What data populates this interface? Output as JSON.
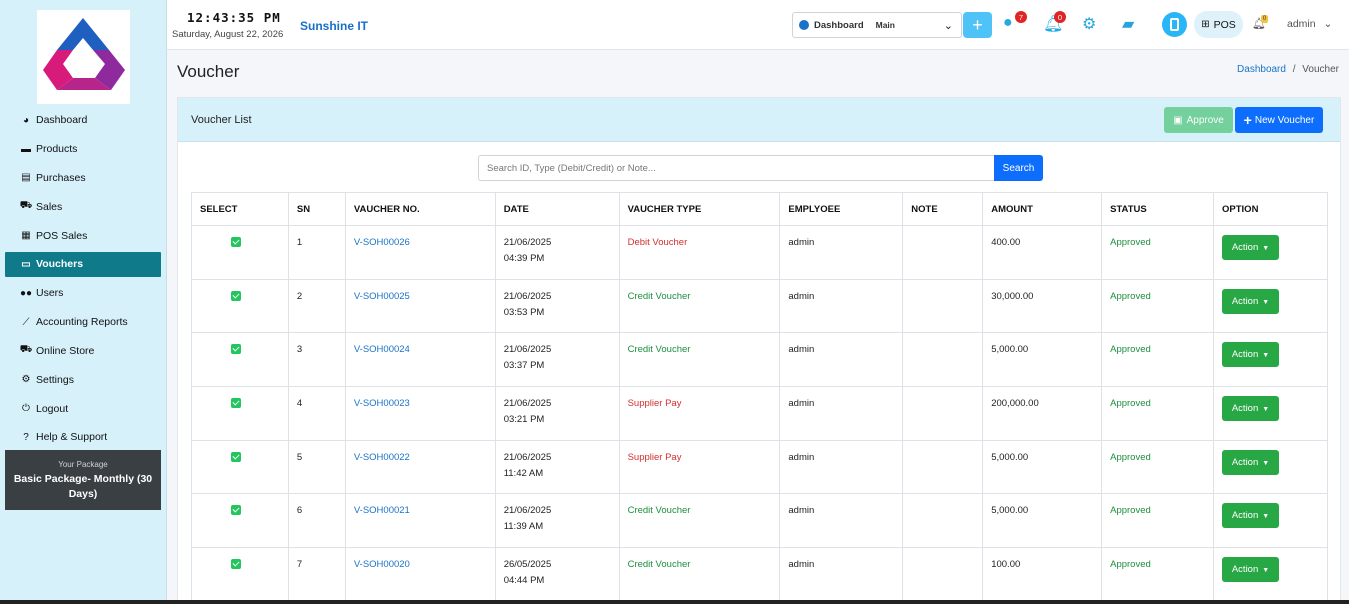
{
  "header": {
    "clock": "12:43:35 PM",
    "date": "Saturday, August 22, 2026",
    "brand": "Sunshine IT",
    "dashboard_select_label": "Dashboard",
    "dashboard_select_value": "Main",
    "notif_count_1": "7",
    "notif_count_2": "0",
    "pos_label": "POS",
    "bell_count": "0",
    "user": "admin"
  },
  "sidebar": {
    "items": [
      {
        "label": "Dashboard",
        "icon": "dashboard-icon"
      },
      {
        "label": "Products",
        "icon": "box-icon"
      },
      {
        "label": "Purchases",
        "icon": "receipt-icon"
      },
      {
        "label": "Sales",
        "icon": "cart-icon"
      },
      {
        "label": "POS Sales",
        "icon": "cash-register-icon"
      },
      {
        "label": "Vouchers",
        "icon": "voucher-icon",
        "active": true
      },
      {
        "label": "Users",
        "icon": "users-icon"
      },
      {
        "label": "Accounting Reports",
        "icon": "chart-line-icon"
      },
      {
        "label": "Online Store",
        "icon": "cart-icon"
      },
      {
        "label": "Settings",
        "icon": "gears-icon"
      },
      {
        "label": "Logout",
        "icon": "logout-icon"
      },
      {
        "label": "Help & Support",
        "icon": "help-icon"
      }
    ],
    "package_caption": "Your Package",
    "package_name": "Basic Package- Monthly (30 Days)"
  },
  "page": {
    "title": "Voucher",
    "breadcrumb_home": "Dashboard",
    "breadcrumb_sep": "/",
    "breadcrumb_current": "Voucher"
  },
  "card": {
    "title": "Voucher List",
    "approve_label": "Approve",
    "new_voucher_label": "New Voucher",
    "search_placeholder": "Search ID, Type (Debit/Credit) or Note...",
    "search_button": "Search"
  },
  "table": {
    "headers": [
      "SELECT",
      "SN",
      "VAUCHER NO.",
      "DATE",
      "VAUCHER TYPE",
      "EMPLYOEE",
      "NOTE",
      "AMOUNT",
      "STATUS",
      "OPTION"
    ],
    "rows": [
      {
        "sn": "1",
        "no": "V-SOH00026",
        "date": "21/06/2025",
        "time": "04:39 PM",
        "type": "Debit Voucher",
        "type_color": "red",
        "employee": "admin",
        "note": "",
        "amount": "400.00",
        "status": "Approved",
        "action": "Action"
      },
      {
        "sn": "2",
        "no": "V-SOH00025",
        "date": "21/06/2025",
        "time": "03:53 PM",
        "type": "Credit Voucher",
        "type_color": "green",
        "employee": "admin",
        "note": "",
        "amount": "30,000.00",
        "status": "Approved",
        "action": "Action"
      },
      {
        "sn": "3",
        "no": "V-SOH00024",
        "date": "21/06/2025",
        "time": "03:37 PM",
        "type": "Credit Voucher",
        "type_color": "green",
        "employee": "admin",
        "note": "",
        "amount": "5,000.00",
        "status": "Approved",
        "action": "Action"
      },
      {
        "sn": "4",
        "no": "V-SOH00023",
        "date": "21/06/2025",
        "time": "03:21 PM",
        "type": "Supplier Pay",
        "type_color": "red",
        "employee": "admin",
        "note": "",
        "amount": "200,000.00",
        "status": "Approved",
        "action": "Action"
      },
      {
        "sn": "5",
        "no": "V-SOH00022",
        "date": "21/06/2025",
        "time": "11:42 AM",
        "type": "Supplier Pay",
        "type_color": "red",
        "employee": "admin",
        "note": "",
        "amount": "5,000.00",
        "status": "Approved",
        "action": "Action"
      },
      {
        "sn": "6",
        "no": "V-SOH00021",
        "date": "21/06/2025",
        "time": "11:39 AM",
        "type": "Credit Voucher",
        "type_color": "green",
        "employee": "admin",
        "note": "",
        "amount": "5,000.00",
        "status": "Approved",
        "action": "Action"
      },
      {
        "sn": "7",
        "no": "V-SOH00020",
        "date": "26/05/2025",
        "time": "04:44 PM",
        "type": "Credit Voucher",
        "type_color": "green",
        "employee": "admin",
        "note": "",
        "amount": "100.00",
        "status": "Approved",
        "action": "Action"
      }
    ]
  }
}
